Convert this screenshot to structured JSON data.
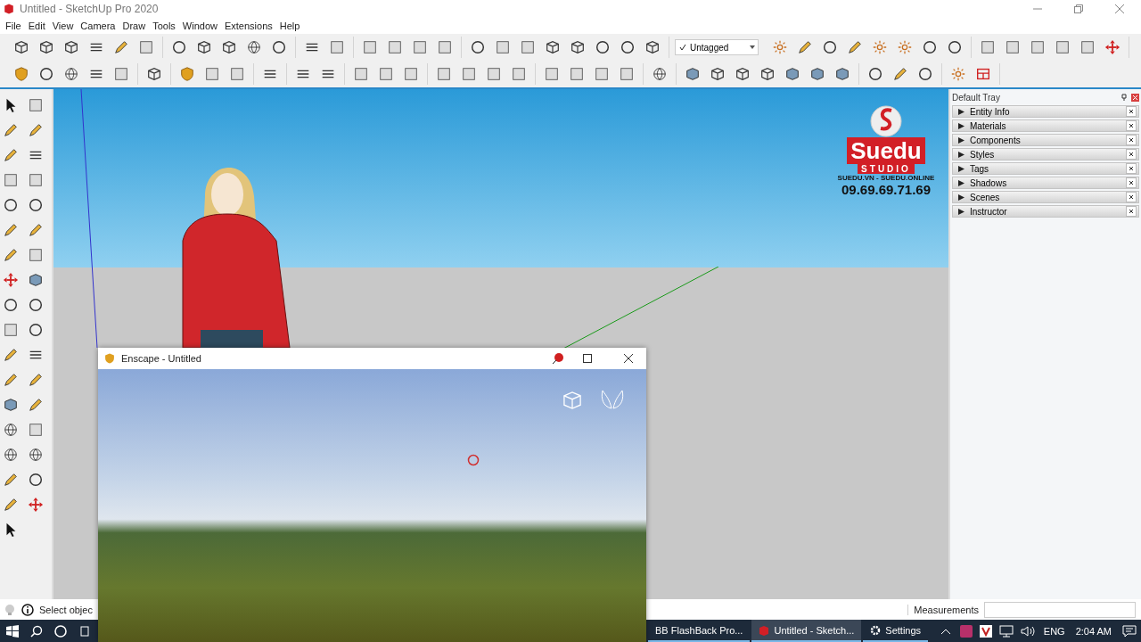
{
  "window": {
    "title": "Untitled - SketchUp Pro 2020"
  },
  "menu": [
    "File",
    "Edit",
    "View",
    "Camera",
    "Draw",
    "Tools",
    "Window",
    "Extensions",
    "Help"
  ],
  "tag_dropdown": {
    "value": "Untagged"
  },
  "logo": {
    "brand": "Suedu",
    "subtitle": "STUDIO",
    "sites": "SUEDU.VN - SUEDU.ONLINE",
    "phone": "09.69.69.71.69"
  },
  "tray": {
    "title": "Default Tray",
    "panels": [
      {
        "label": "Entity Info",
        "expanded": false
      },
      {
        "label": "Materials",
        "expanded": false
      },
      {
        "label": "Components",
        "expanded": false
      },
      {
        "label": "Styles",
        "expanded": false
      },
      {
        "label": "Tags",
        "expanded": false
      },
      {
        "label": "Shadows",
        "expanded": false
      },
      {
        "label": "Scenes",
        "expanded": false
      },
      {
        "label": "Instructor",
        "expanded": false
      }
    ]
  },
  "status_bar": {
    "hint": "Select objec",
    "measurements_label": "Measurements"
  },
  "enscape_window": {
    "title": "Enscape - Untitled"
  },
  "taskbar": {
    "apps": [
      {
        "label": "BB FlashBack Pro...",
        "active": false,
        "kind": "plain"
      },
      {
        "label": "Untitled - Sketch...",
        "active": true,
        "kind": "sketchup"
      },
      {
        "label": "Settings",
        "active": false,
        "kind": "gear"
      }
    ],
    "language": "ENG",
    "time": "2:04 AM"
  }
}
